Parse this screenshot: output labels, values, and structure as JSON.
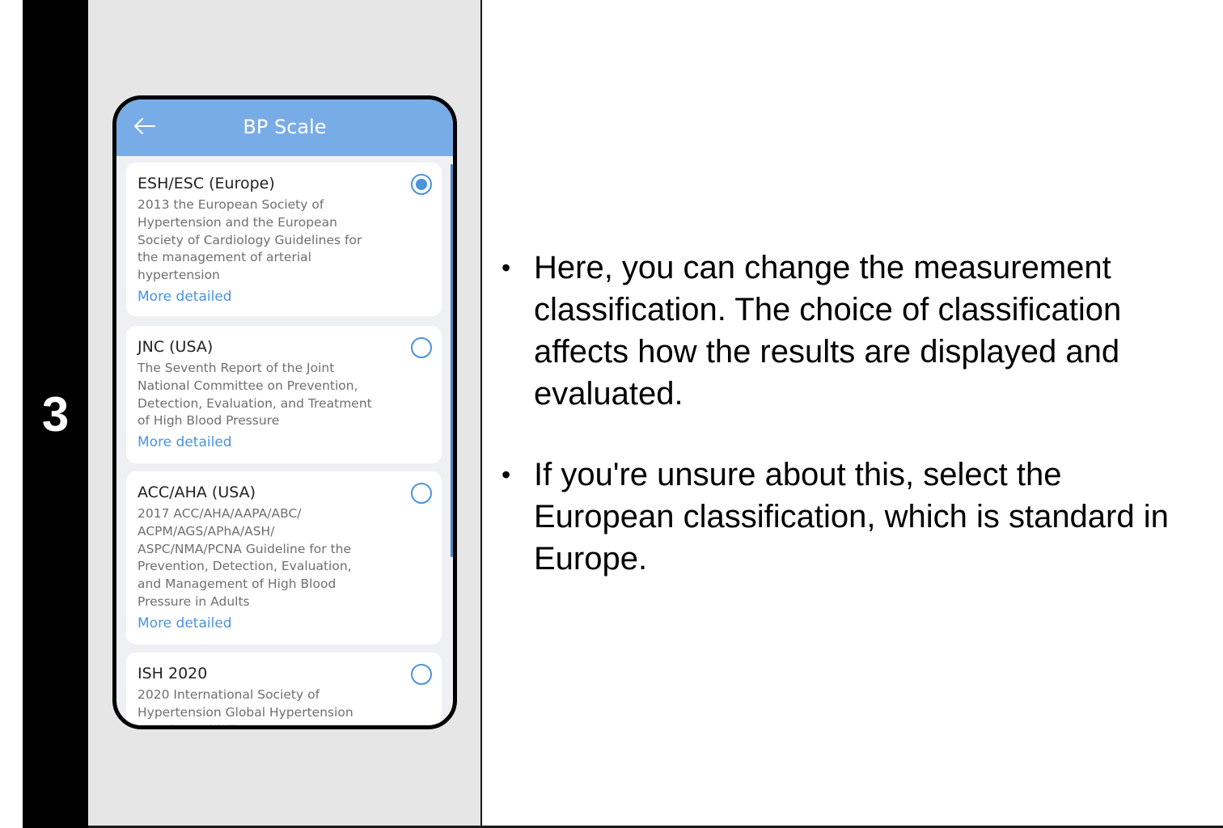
{
  "step": {
    "number": "3"
  },
  "app": {
    "title": "BP Scale",
    "options": [
      {
        "title": "ESH/ESC (Europe)",
        "description": "2013 the European Society of\nHypertension and the European\nSociety of Cardiology Guidelines for\nthe management of arterial\nhypertension",
        "link": "More detailed",
        "selected": true
      },
      {
        "title": "JNC (USA)",
        "description": "The Seventh Report of the Joint\nNational Committee on Prevention,\nDetection, Evaluation, and Treatment\nof High Blood Pressure",
        "link": "More detailed",
        "selected": false
      },
      {
        "title": "ACC/AHA (USA)",
        "description": "2017 ACC/AHA/AAPA/ABC/\nACPM/AGS/APhA/ASH/\nASPC/NMA/PCNA Guideline for the\nPrevention, Detection, Evaluation,\nand Management of High Blood\nPressure in Adults",
        "link": "More detailed",
        "selected": false
      },
      {
        "title": "ISH 2020",
        "description": "2020 International Society of\nHypertension Global Hypertension\nPractice Guidelines",
        "selected": false
      }
    ]
  },
  "instructions": [
    "Here, you can change the measurement classification. The choice of classification affects how the results are displayed and evaluated.",
    "If you're unsure about this, select the European classification, which is standard in Europe."
  ],
  "colors": {
    "header": "#78ace6",
    "accent": "#4b93de",
    "panel": "#e6e6e6"
  },
  "icons": {
    "back": "arrow-left-icon",
    "bullet": "•"
  }
}
